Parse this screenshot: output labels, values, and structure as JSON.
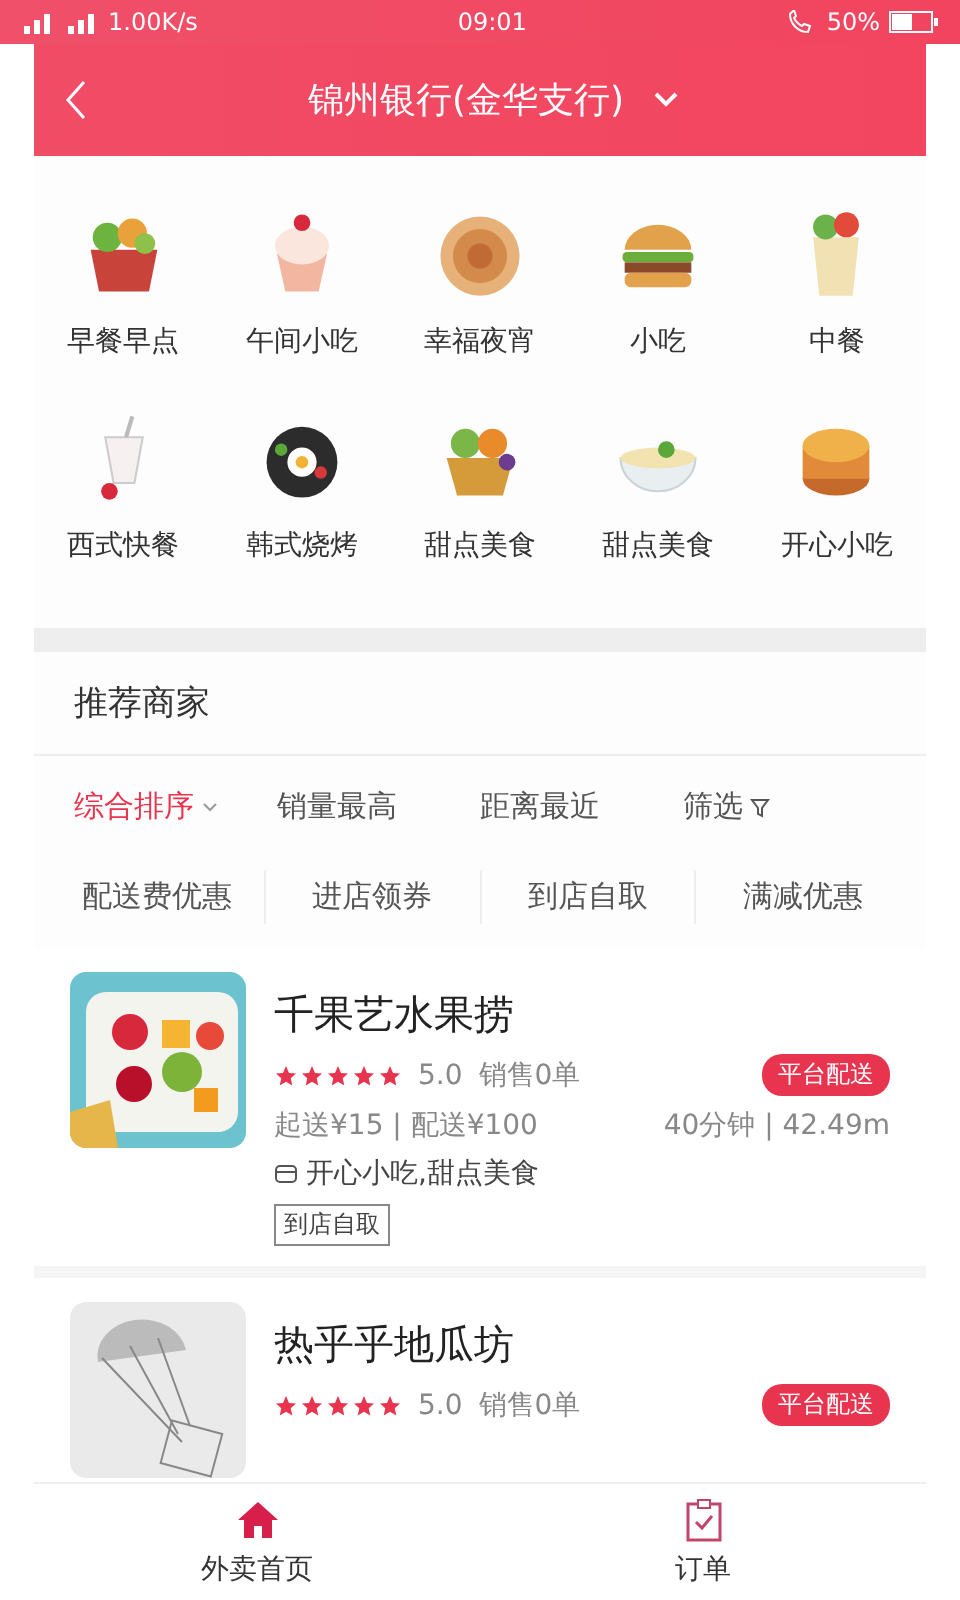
{
  "status_bar": {
    "speed": "1.00K/s",
    "time": "09:01",
    "battery": "50%"
  },
  "header": {
    "title": "锦州银行(金华支行)"
  },
  "categories": [
    {
      "label": "早餐早点"
    },
    {
      "label": "午间小吃"
    },
    {
      "label": "幸福夜宵"
    },
    {
      "label": "小吃"
    },
    {
      "label": "中餐"
    },
    {
      "label": "西式快餐"
    },
    {
      "label": "韩式烧烤"
    },
    {
      "label": "甜点美食"
    },
    {
      "label": "甜点美食"
    },
    {
      "label": "开心小吃"
    }
  ],
  "section_title": "推荐商家",
  "sort_options": [
    {
      "label": "综合排序",
      "kind": "dropdown",
      "selected": true
    },
    {
      "label": "销量最高",
      "kind": "plain",
      "selected": false
    },
    {
      "label": "距离最近",
      "kind": "plain",
      "selected": false
    },
    {
      "label": "筛选",
      "kind": "filter",
      "selected": false
    }
  ],
  "filters": [
    "配送费优惠",
    "进店领券",
    "到店自取",
    "满减优惠"
  ],
  "stores": [
    {
      "name": "千果艺水果捞",
      "kind": "picture",
      "stars": 5,
      "rating": "5.0",
      "sales": "销售0单",
      "badge": "平台配送",
      "fees": "起送¥15 | 配送¥100",
      "eta": "40分钟 | 42.49m",
      "categories": "开心小吃,甜点美食",
      "tags": [
        "到店自取"
      ]
    },
    {
      "name": "热乎乎地瓜坊",
      "kind": "placeholder",
      "stars": 5,
      "rating": "5.0",
      "sales": "销售0单",
      "badge": "平台配送"
    }
  ],
  "bottom_tabs": [
    {
      "label": "外卖首页",
      "kind": "home",
      "selected": true
    },
    {
      "label": "订单",
      "kind": "orders",
      "selected": false
    }
  ]
}
